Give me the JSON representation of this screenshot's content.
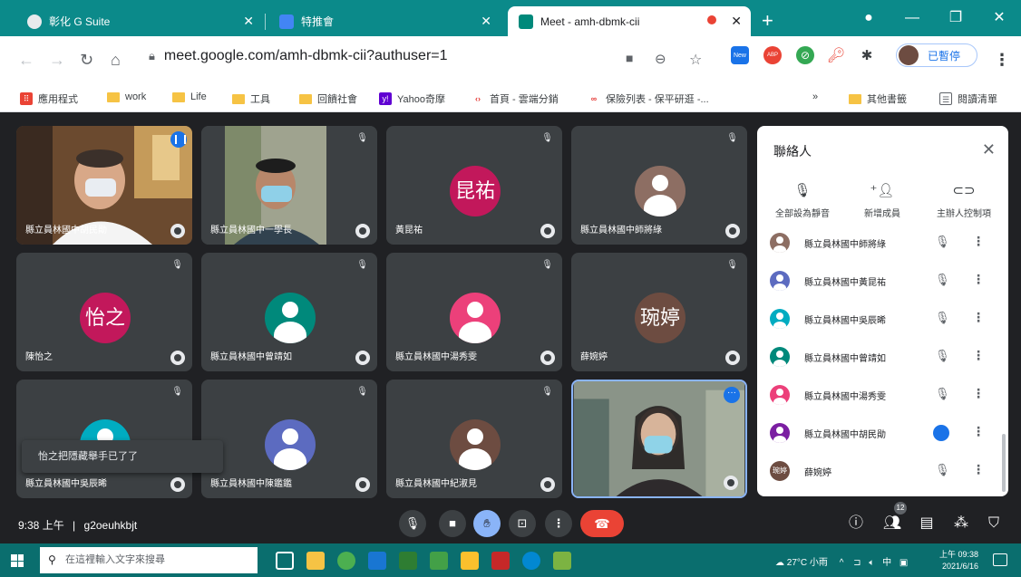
{
  "browser": {
    "tabs": [
      {
        "title": "彰化 G Suite",
        "favicon_color": "#e8eaed"
      },
      {
        "title": "特推會",
        "favicon_color": "#4285f4"
      },
      {
        "title": "Meet - amh-dbmk-cii",
        "favicon_color": "#00897b"
      }
    ],
    "url": "meet.google.com/amh-dbmk-cii?authuser=1",
    "profile_label": "已暫停",
    "bookmarks": [
      "應用程式",
      "work",
      "Life",
      "工具",
      "回饋社會",
      "Yahoo奇摩",
      "首頁 - 雲端分銷",
      "保險列表 - 保平研逛 -...",
      "其他書籤",
      "閱讀清單"
    ]
  },
  "meet": {
    "tiles": [
      {
        "name": "縣立員林國中胡民勛",
        "type": "video",
        "speaking": true
      },
      {
        "name": "縣立員林國中一學長",
        "type": "video"
      },
      {
        "name": "黃昆祐",
        "type": "letter",
        "initials": "昆祐",
        "color": "#c2185b"
      },
      {
        "name": "縣立員林國中師將綠",
        "type": "person",
        "color": "#8d6e63"
      },
      {
        "name": "陳怡之",
        "type": "letter",
        "initials": "怡之",
        "color": "#c2185b"
      },
      {
        "name": "縣立員林國中曾靖如",
        "type": "person",
        "color": "#00897b"
      },
      {
        "name": "縣立員林國中湯秀雯",
        "type": "person",
        "color": "#ec407a"
      },
      {
        "name": "薛婉婷",
        "type": "letter",
        "initials": "琬婷",
        "color": "#6d4c41"
      },
      {
        "name": "縣立員林國中吳辰晞",
        "type": "person",
        "color": "#00acc1"
      },
      {
        "name": "縣立員林國中陳鑑鑑",
        "type": "person",
        "color": "#5c6bc0"
      },
      {
        "name": "縣立員林國中紀淑見",
        "type": "person",
        "color": "#6d4c41"
      },
      {
        "name": "",
        "type": "self"
      }
    ],
    "toast": "怡之把隱藏舉手已了了",
    "meeting_time": "9:38 上午",
    "meeting_code": "g2oeuhkbjt",
    "people_count": "12"
  },
  "panel": {
    "title": "聯絡人",
    "actions": [
      "全部設為靜音",
      "新增成員",
      "主辦人控制項"
    ],
    "people": [
      {
        "name": "縣立員林國中師將綠",
        "color": "#8d6e63",
        "mic": "muted"
      },
      {
        "name": "縣立員林國中黃昆祐",
        "color": "#5c6bc0",
        "mic": "muted"
      },
      {
        "name": "縣立員林國中吳辰晞",
        "color": "#00acc1",
        "mic": "muted"
      },
      {
        "name": "縣立員林國中曾靖如",
        "color": "#00897b",
        "mic": "muted"
      },
      {
        "name": "縣立員林國中湯秀雯",
        "color": "#ec407a",
        "mic": "muted"
      },
      {
        "name": "縣立員林國中胡民勛",
        "color": "#7b1fa2",
        "mic": "active"
      },
      {
        "name": "薛婉婷",
        "color": "#6d4c41",
        "mic": "muted",
        "initials": "琬婷"
      }
    ]
  },
  "taskbar": {
    "search_placeholder": "在這裡輸入文字來搜尋",
    "weather": "27°C 小雨",
    "ime": "中",
    "time": "上午 09:38",
    "date": "2021/6/16"
  }
}
